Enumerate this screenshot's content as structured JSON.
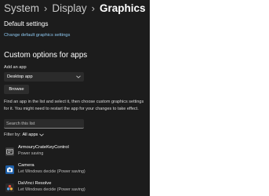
{
  "breadcrumb": {
    "items": [
      "System",
      "Display"
    ],
    "current": "Graphics",
    "separator": "›"
  },
  "default_settings": {
    "heading": "Default settings",
    "link": "Change default graphics settings"
  },
  "custom": {
    "heading": "Custom options for apps",
    "add_label": "Add an app",
    "dropdown_value": "Desktop app",
    "browse_label": "Browse",
    "description": "Find an app in the list and select it, then choose custom graphics settings for it. You might need to restart the app for your changes to take effect.",
    "search_placeholder": "Search this list",
    "filter_label": "Filter by:",
    "filter_value": "All apps"
  },
  "apps": [
    {
      "name": "ArmouryCrateKeyControl",
      "setting": "Power saving",
      "icon": "armoury-crate-icon"
    },
    {
      "name": "Camera",
      "setting": "Let Windows decide (Power saving)",
      "icon": "camera-icon"
    },
    {
      "name": "DaVinci Resolve",
      "setting": "Let Windows decide (Power saving)",
      "icon": "davinci-resolve-icon"
    }
  ],
  "colors": {
    "panel_bg": "#1c1c1c",
    "link": "#8ec8f0",
    "control_bg": "#2b2b2b"
  }
}
